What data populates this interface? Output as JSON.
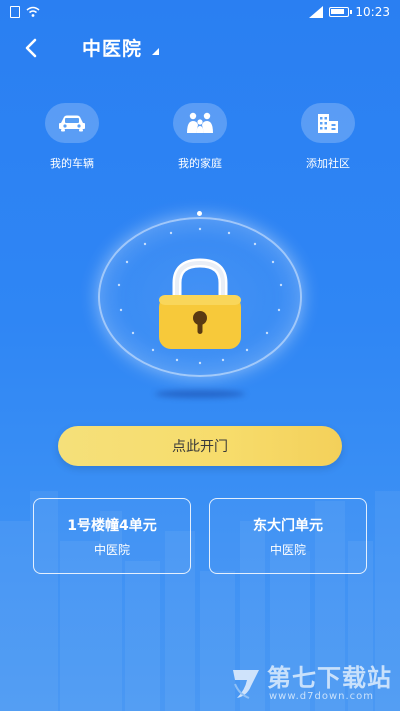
{
  "status_bar": {
    "time": "10:23"
  },
  "header": {
    "community_name": "中医院"
  },
  "quick_menu": {
    "items": [
      {
        "label": "我的车辆",
        "icon": "car-icon"
      },
      {
        "label": "我的家庭",
        "icon": "family-icon"
      },
      {
        "label": "添加社区",
        "icon": "building-icon"
      }
    ]
  },
  "lock": {
    "icon": "padlock-icon"
  },
  "open_button": {
    "label": "点此开门"
  },
  "doors": [
    {
      "title": "1号楼幢4单元",
      "subtitle": "中医院"
    },
    {
      "title": "东大门单元",
      "subtitle": "中医院"
    }
  ],
  "watermark": {
    "main": "第七下载站",
    "sub": "www.d7down.com"
  },
  "colors": {
    "background": "#2f86f4",
    "button_yellow": "#f7dc6b",
    "lock_yellow": "#f7c93a"
  }
}
